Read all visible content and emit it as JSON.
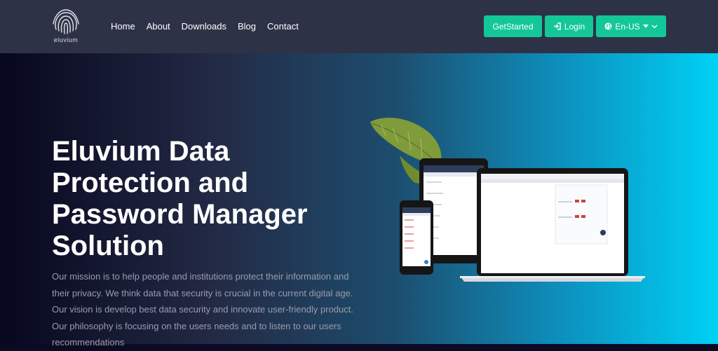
{
  "brand": {
    "logo_text": "eluvium"
  },
  "nav": {
    "items": [
      {
        "label": "Home"
      },
      {
        "label": "About"
      },
      {
        "label": "Downloads"
      },
      {
        "label": "Blog"
      },
      {
        "label": "Contact"
      }
    ],
    "get_started_label": "GetStarted",
    "login_label": "Login",
    "language_label": "En-US"
  },
  "hero": {
    "title": "Eluvium Data Protection and Password Manager Solution",
    "description": "Our mission is to help people and institutions protect their information and their privacy. We think data that security is crucial in the current digital age. Our vision is develop best data security and innovate user-friendly product. Our philosophy is focusing on the users needs and to listen to our users recommendations"
  },
  "colors": {
    "nav_bg": "#2e3247",
    "button_green": "#13c798",
    "accent_cyan": "#00d1f5"
  },
  "icons": {
    "login": "sign-in-icon",
    "language": "globe-icon",
    "caret": "caret-down-icon",
    "chevron": "chevron-down-icon"
  }
}
